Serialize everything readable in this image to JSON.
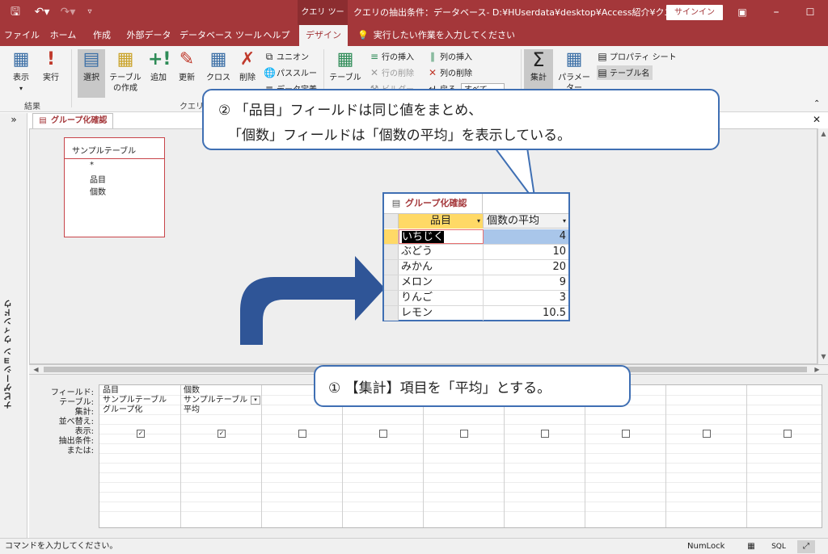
{
  "titlebar": {
    "contextual_tab_group": "クエリ ツール",
    "document_title": "クエリの抽出条件：データベース- D:¥HUserdata¥desktop¥Access紹介¥クエリの抽…",
    "signin_label": "サインイン"
  },
  "ribbon_tabs": [
    {
      "label": "ファイル"
    },
    {
      "label": "ホーム"
    },
    {
      "label": "作成"
    },
    {
      "label": "外部データ"
    },
    {
      "label": "データベース ツール"
    },
    {
      "label": "ヘルプ"
    },
    {
      "label": "デザイン"
    }
  ],
  "tell_me": "実行したい作業を入力してください",
  "ribbon": {
    "view_label": "表示",
    "run_label": "実行",
    "results_group": "結果",
    "select_label": "選択",
    "make_table_label": "テーブルの作成",
    "append_label": "追加",
    "update_label": "更新",
    "crosstab_label": "クロス",
    "delete_label": "削除",
    "union_label": "ユニオン",
    "passthrough_label": "パススルー",
    "data_def_label": "データ定義",
    "query_type_group": "クエリの",
    "show_table_label": "テーブル",
    "insert_rows_label": "行の挿入",
    "delete_rows_label": "行の削除",
    "builder_label": "ビルダー",
    "insert_cols_label": "列の挿入",
    "delete_cols_label": "列の削除",
    "return_label": "戻る",
    "return_value": "すべて",
    "totals_label": "集計",
    "parameters_label": "パラメーター",
    "property_sheet_label": "プロパティ シート",
    "table_names_label": "テーブル名"
  },
  "navigation_pane_label": "ナビゲーション ウィンドウ",
  "document_tab": "グループ化確認",
  "table_box": {
    "title": "サンプルテーブル",
    "fields": [
      "*",
      "品目",
      "個数"
    ]
  },
  "callout_2": {
    "line1": "② 「品目」フィールドは同じ値をまとめ、",
    "line2": "「個数」フィールドは「個数の平均」を表示している。"
  },
  "callout_1": {
    "text": "① 【集計】項目を「平均」とする。"
  },
  "datasheet": {
    "tab": "グループ化確認",
    "headers": [
      "品目",
      "個数の平均"
    ],
    "rows": [
      {
        "item": "いちじく",
        "avg": "4"
      },
      {
        "item": "ぶどう",
        "avg": "10"
      },
      {
        "item": "みかん",
        "avg": "20"
      },
      {
        "item": "メロン",
        "avg": "9"
      },
      {
        "item": "りんご",
        "avg": "3"
      },
      {
        "item": "レモン",
        "avg": "10.5"
      }
    ]
  },
  "design_grid": {
    "row_labels": [
      "フィールド:",
      "テーブル:",
      "集計:",
      "並べ替え:",
      "表示:",
      "抽出条件:",
      "または:"
    ],
    "col1": {
      "field": "品目",
      "table": "サンプルテーブル",
      "total": "グループ化"
    },
    "col2": {
      "field": "個数",
      "table": "サンプルテーブル",
      "total": "平均"
    }
  },
  "status": {
    "text": "コマンドを入力してください。",
    "numlock": "NumLock",
    "sql_view": "SQL"
  }
}
